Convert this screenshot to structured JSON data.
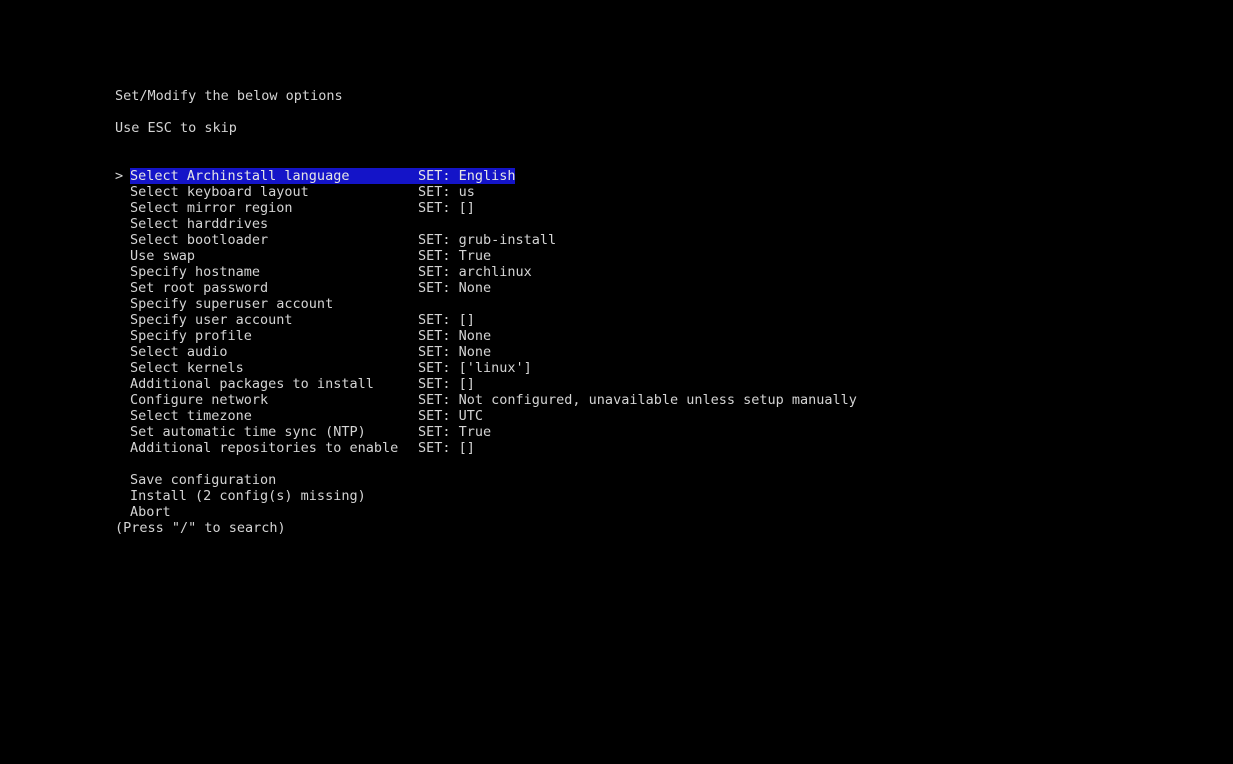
{
  "header": {
    "line1": "Set/Modify the below options",
    "line2": "Use ESC to skip"
  },
  "cursor": ">",
  "menu": [
    {
      "label": "Select Archinstall language",
      "value": "SET: English"
    },
    {
      "label": "Select keyboard layout",
      "value": "SET: us"
    },
    {
      "label": "Select mirror region",
      "value": "SET: []"
    },
    {
      "label": "Select harddrives",
      "value": ""
    },
    {
      "label": "Select bootloader",
      "value": "SET: grub-install"
    },
    {
      "label": "Use swap",
      "value": "SET: True"
    },
    {
      "label": "Specify hostname",
      "value": "SET: archlinux"
    },
    {
      "label": "Set root password",
      "value": "SET: None"
    },
    {
      "label": "Specify superuser account",
      "value": ""
    },
    {
      "label": "Specify user account",
      "value": "SET: []"
    },
    {
      "label": "Specify profile",
      "value": "SET: None"
    },
    {
      "label": "Select audio",
      "value": "SET: None"
    },
    {
      "label": "Select kernels",
      "value": "SET: ['linux']"
    },
    {
      "label": "Additional packages to install",
      "value": "SET: []"
    },
    {
      "label": "Configure network",
      "value": "SET: Not configured, unavailable unless setup manually"
    },
    {
      "label": "Select timezone",
      "value": "SET: UTC"
    },
    {
      "label": "Set automatic time sync (NTP)",
      "value": "SET: True"
    },
    {
      "label": "Additional repositories to enable",
      "value": "SET: []"
    }
  ],
  "actions": {
    "save": "Save configuration",
    "install": "Install (2 config(s) missing)",
    "abort": "Abort"
  },
  "footer": "(Press \"/\" to search)",
  "colors": {
    "background": "#000000",
    "text": "#d4d4d4",
    "highlight": "#1414c8"
  }
}
